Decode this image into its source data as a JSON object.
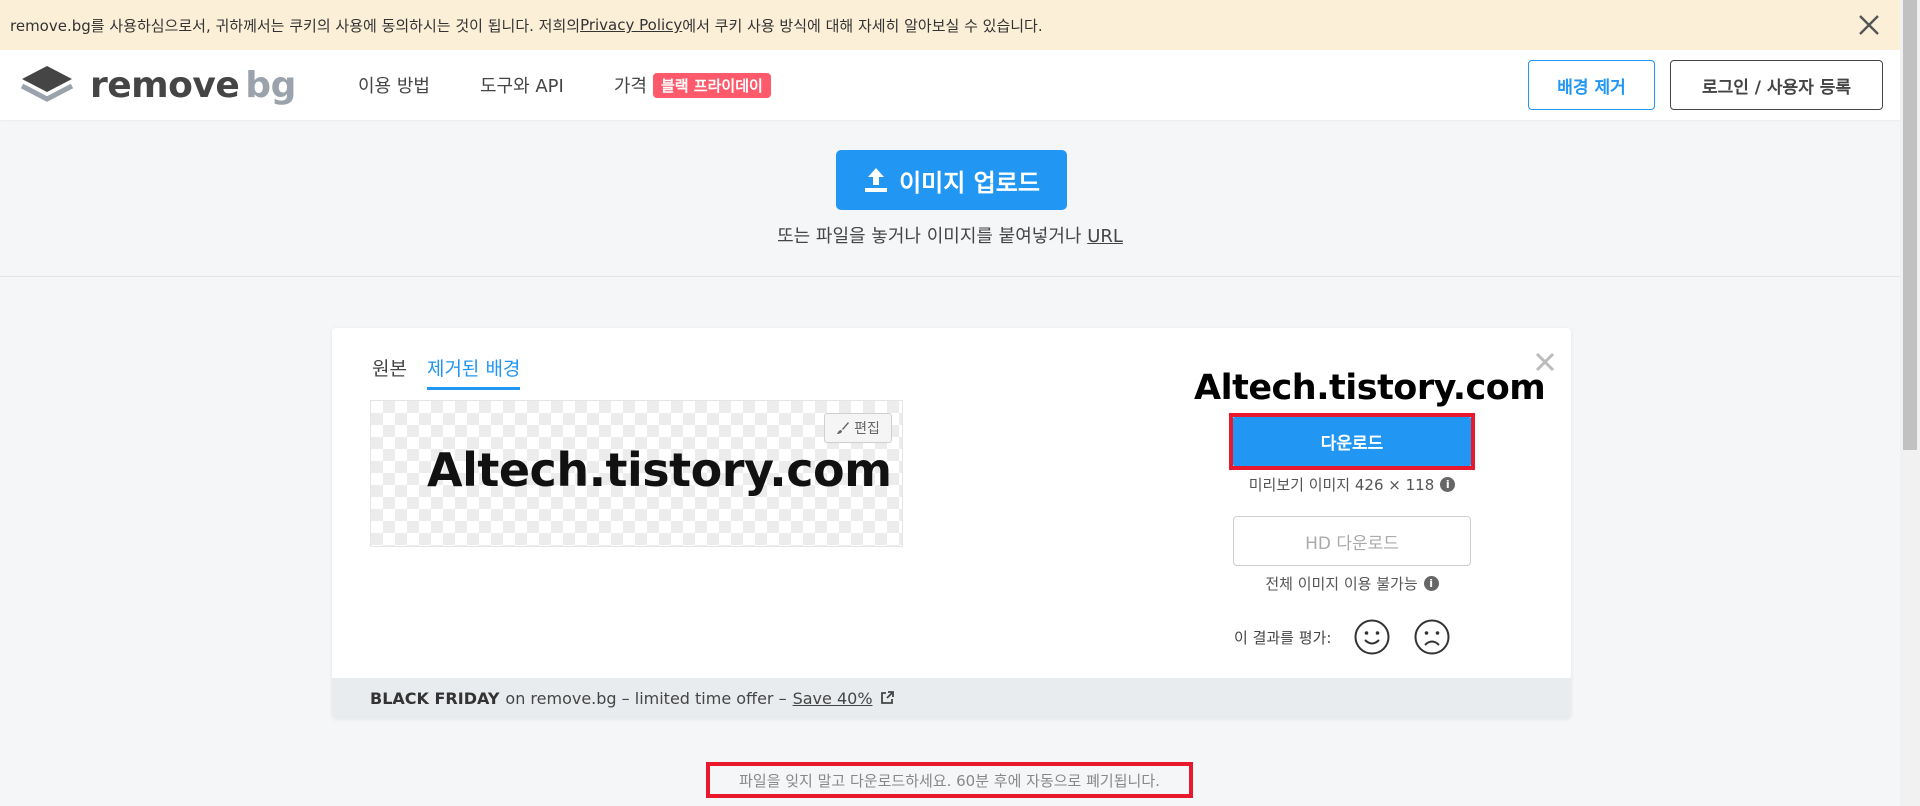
{
  "cookie_banner": {
    "text_before": "remove.bg를 사용하심으로서, 귀하께서는 쿠키의 사용에 동의하시는 것이 됩니다. 저희의 ",
    "link": "Privacy Policy",
    "text_after": "에서 쿠키 사용 방식에 대해 자세히 알아보실 수 있습니다."
  },
  "header": {
    "logo_main": "remove",
    "logo_suffix": "bg",
    "nav": [
      "이용 방법",
      "도구와 API",
      "가격"
    ],
    "badge": "블랙 프라이데이",
    "remove_bg_button": "배경 제거",
    "login_button": "로그인 / 사용자 등록"
  },
  "upload": {
    "button": "이미지 업로드",
    "hint": "또는 파일을 놓거나 이미지를 붙여넣거나 ",
    "url_link": "URL"
  },
  "result": {
    "tabs": [
      "원본",
      "제거된 배경"
    ],
    "active_tab": 1,
    "preview_text": "Altech.tistory.com",
    "edit_button": "편집",
    "watermark": "Altech.tistory.com",
    "download_button": "다운로드",
    "preview_info": "미리보기 이미지 426 × 118",
    "hd_button": "HD 다운로드",
    "full_image_info": "전체 이미지 이용 불가능",
    "rate_label": "이 결과를 평가:"
  },
  "promo": {
    "bold": "BLACK FRIDAY",
    "text": "on remove.bg – limited time offer –",
    "link": "Save 40%"
  },
  "note": "파일을 잊지 말고 다운로드하세요. 60분 후에 자동으로 폐기됩니다.",
  "colors": {
    "accent": "#2196f3",
    "badge": "#ff5a6b",
    "highlight": "#e8192c",
    "banner": "#fcefd8"
  }
}
